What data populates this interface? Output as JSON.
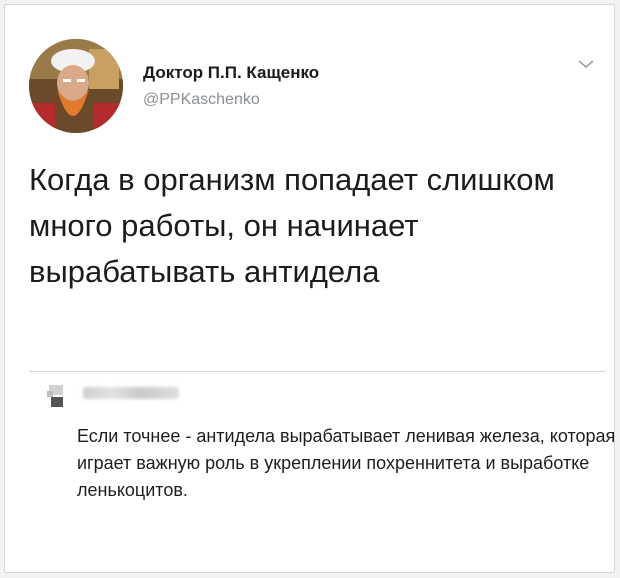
{
  "tweet": {
    "author_name": "Доктор П.П. Кащенко",
    "handle": "@PPKaschenko",
    "text": "Когда в организм попадает слишком много работы, он начинает вырабатывать антидела",
    "menu_icon": "chevron-down-icon"
  },
  "reply": {
    "text": "Если точнее - антидела вырабатывает ленивая железа, которая играет важную роль в укреплении похреннитета и выработке ленькоцитов."
  },
  "colors": {
    "background": "#ffffff",
    "text": "#1c1c1c",
    "secondary_text": "#8a8f94",
    "divider": "#d4d4d4"
  }
}
